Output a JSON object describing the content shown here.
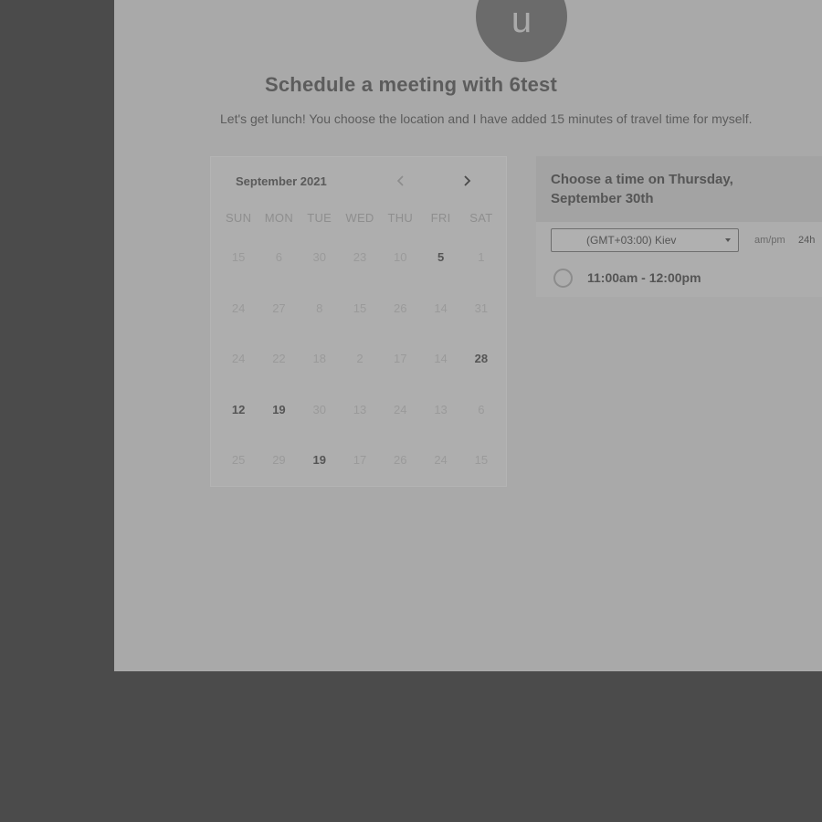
{
  "profile": {
    "avatar_letter": "u"
  },
  "header": {
    "title": "Schedule a meeting with 6test",
    "description": "Let's get lunch! You choose the location and I have added 15 minutes of travel time for myself."
  },
  "calendar": {
    "month_label": "September 2021",
    "prev_icon": "chevron-left-icon",
    "next_icon": "chevron-right-icon",
    "weekdays": [
      "SUN",
      "MON",
      "TUE",
      "WED",
      "THU",
      "FRI",
      "SAT"
    ],
    "weeks": [
      [
        {
          "d": "15",
          "a": false
        },
        {
          "d": "6",
          "a": false
        },
        {
          "d": "30",
          "a": false
        },
        {
          "d": "23",
          "a": false
        },
        {
          "d": "10",
          "a": false
        },
        {
          "d": "5",
          "a": true
        },
        {
          "d": "1",
          "a": false
        }
      ],
      [
        {
          "d": "24",
          "a": false
        },
        {
          "d": "27",
          "a": false
        },
        {
          "d": "8",
          "a": false
        },
        {
          "d": "15",
          "a": false
        },
        {
          "d": "26",
          "a": false
        },
        {
          "d": "14",
          "a": false
        },
        {
          "d": "31",
          "a": false
        }
      ],
      [
        {
          "d": "24",
          "a": false
        },
        {
          "d": "22",
          "a": false
        },
        {
          "d": "18",
          "a": false
        },
        {
          "d": "2",
          "a": false
        },
        {
          "d": "17",
          "a": false
        },
        {
          "d": "14",
          "a": false
        },
        {
          "d": "28",
          "a": true
        }
      ],
      [
        {
          "d": "12",
          "a": true
        },
        {
          "d": "19",
          "a": true
        },
        {
          "d": "30",
          "a": false
        },
        {
          "d": "13",
          "a": false
        },
        {
          "d": "24",
          "a": false
        },
        {
          "d": "13",
          "a": false
        },
        {
          "d": "6",
          "a": false
        }
      ],
      [
        {
          "d": "25",
          "a": false
        },
        {
          "d": "29",
          "a": false
        },
        {
          "d": "19",
          "a": true
        },
        {
          "d": "17",
          "a": false
        },
        {
          "d": "26",
          "a": false
        },
        {
          "d": "24",
          "a": false
        },
        {
          "d": "15",
          "a": false
        }
      ]
    ]
  },
  "times": {
    "title": "Choose a time on Thursday, September 30th",
    "timezone": "(GMT+03:00) Kiev",
    "format_ampm": "am/pm",
    "format_24h": "24h",
    "slots": [
      {
        "label": "11:00am - 12:00pm"
      }
    ]
  }
}
